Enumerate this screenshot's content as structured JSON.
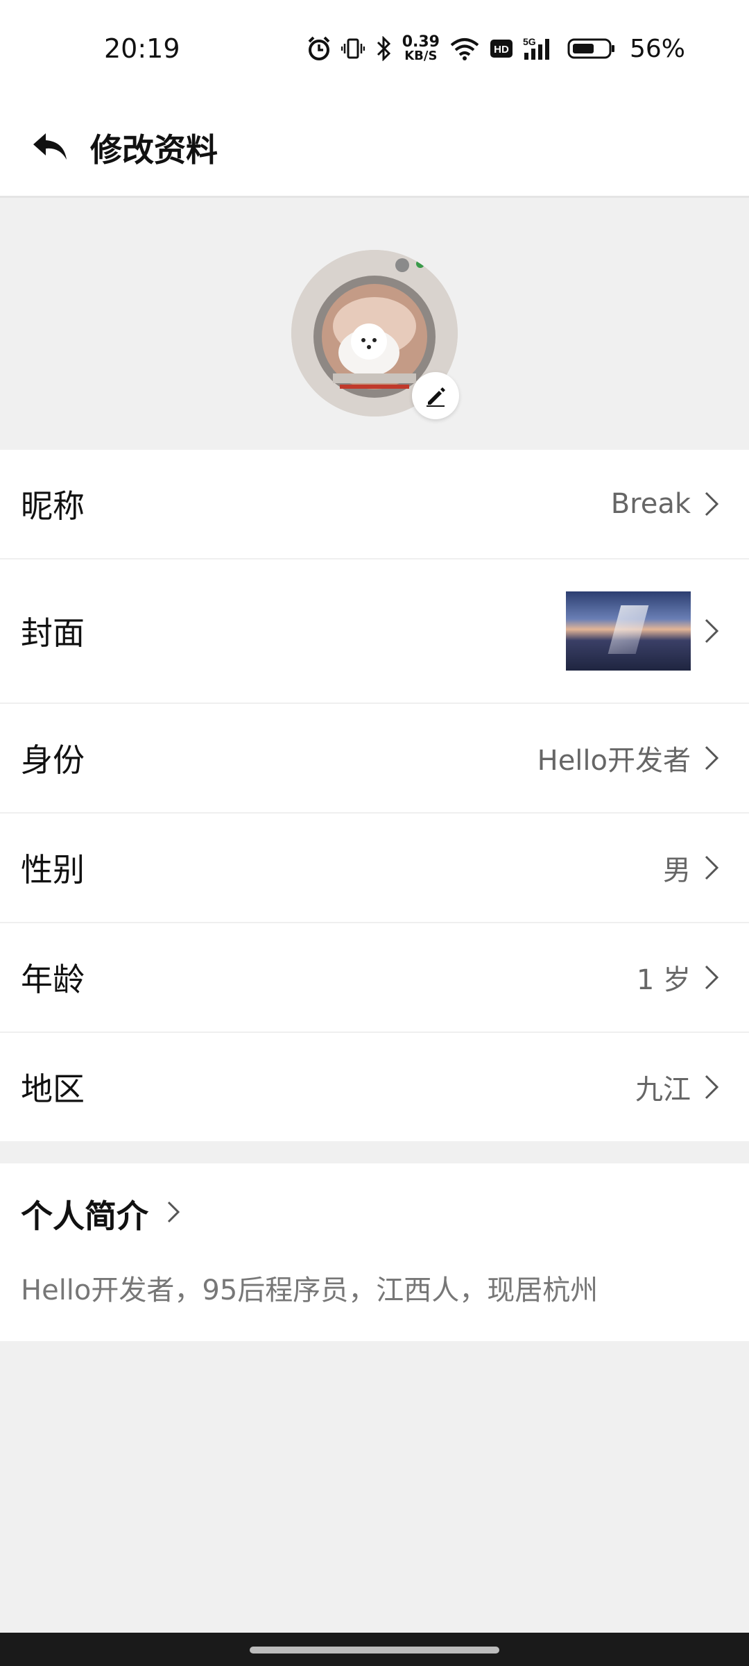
{
  "status_bar": {
    "time": "20:19",
    "net_speed_value": "0.39",
    "net_speed_unit": "KB/S",
    "battery_percent": "56%",
    "icons": [
      "alarm-icon",
      "vibrate-icon",
      "bluetooth-icon",
      "wifi-icon",
      "hd-icon",
      "signal-5g-icon",
      "battery-icon"
    ]
  },
  "header": {
    "title": "修改资料",
    "back_icon": "back-arrow-icon"
  },
  "avatar": {
    "edit_icon": "pencil-icon"
  },
  "rows": [
    {
      "label": "昵称",
      "value": "Break"
    },
    {
      "label": "封面",
      "value": ""
    },
    {
      "label": "身份",
      "value": "Hello开发者"
    },
    {
      "label": "性别",
      "value": "男"
    },
    {
      "label": "年龄",
      "value": "1 岁"
    },
    {
      "label": "地区",
      "value": "九江"
    }
  ],
  "bio": {
    "title": "个人简介",
    "text": "Hello开发者，95后程序员，江西人，现居杭州"
  }
}
